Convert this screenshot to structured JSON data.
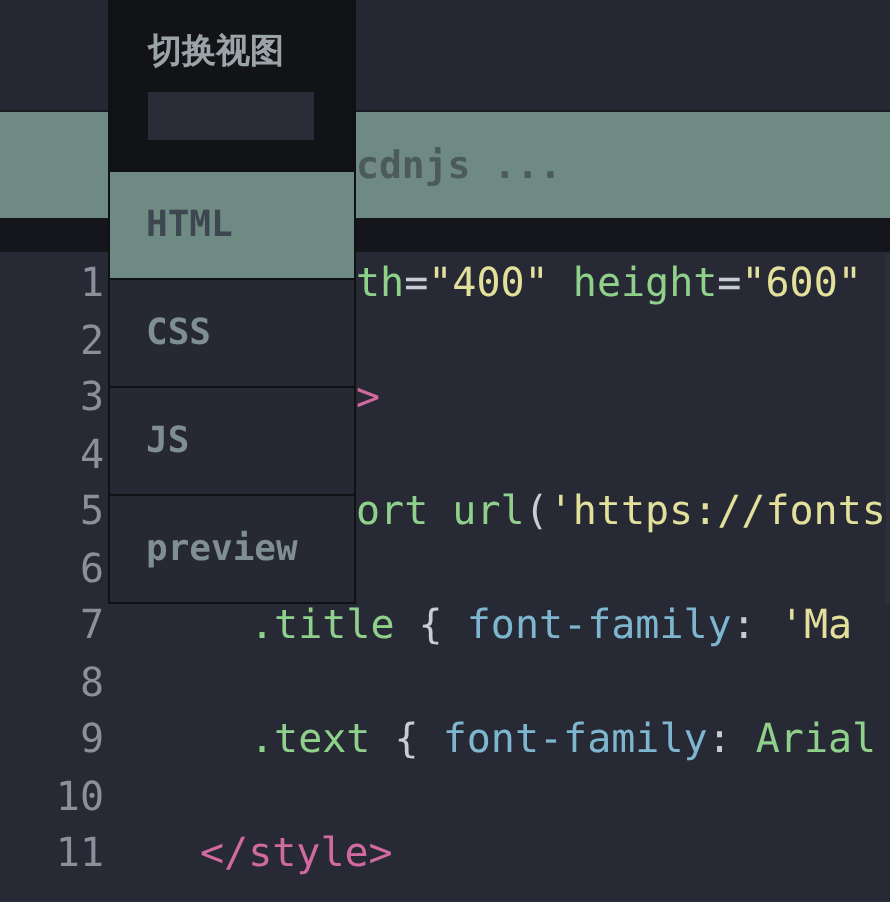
{
  "banner": {
    "text": "cdnjs ..."
  },
  "view_menu": {
    "title": "切换视图",
    "items": [
      {
        "label": "HTML",
        "selected": true
      },
      {
        "label": "CSS",
        "selected": false
      },
      {
        "label": "JS",
        "selected": false
      },
      {
        "label": "preview",
        "selected": false
      }
    ]
  },
  "editor": {
    "lines": [
      {
        "number": "1",
        "kind": "clipped",
        "tokens": [
          {
            "text": "th",
            "kind": "attr"
          },
          {
            "text": "=",
            "kind": "plain"
          },
          {
            "text": "\"400\"",
            "kind": "string"
          },
          {
            "text": " height",
            "kind": "attr"
          },
          {
            "text": "=",
            "kind": "plain"
          },
          {
            "text": "\"600\"",
            "kind": "string"
          }
        ]
      },
      {
        "number": "2"
      },
      {
        "number": "3",
        "kind": "clipped",
        "tokens": [
          {
            "text": ">",
            "kind": "tag"
          }
        ]
      },
      {
        "number": "4"
      },
      {
        "number": "5",
        "kind": "clipped",
        "tokens": [
          {
            "text": "ort url",
            "kind": "attr"
          },
          {
            "text": "(",
            "kind": "plain"
          },
          {
            "text": "'https://fonts",
            "kind": "string"
          }
        ]
      },
      {
        "number": "6"
      },
      {
        "number": "7",
        "kind": "inner",
        "tokens": [
          {
            "text": ".title",
            "kind": "selector"
          },
          {
            "text": " { ",
            "kind": "plain"
          },
          {
            "text": "font-family",
            "kind": "property"
          },
          {
            "text": ": ",
            "kind": "plain"
          },
          {
            "text": "'Ma",
            "kind": "string"
          }
        ]
      },
      {
        "number": "8"
      },
      {
        "number": "9",
        "kind": "inner",
        "tokens": [
          {
            "text": ".text",
            "kind": "selector"
          },
          {
            "text": " { ",
            "kind": "plain"
          },
          {
            "text": "font-family",
            "kind": "property"
          },
          {
            "text": ": ",
            "kind": "plain"
          },
          {
            "text": "Arial",
            "kind": "value"
          }
        ]
      },
      {
        "number": "10"
      },
      {
        "number": "11",
        "kind": "outer",
        "tokens": [
          {
            "text": "</style>",
            "kind": "tag"
          }
        ]
      }
    ]
  }
}
